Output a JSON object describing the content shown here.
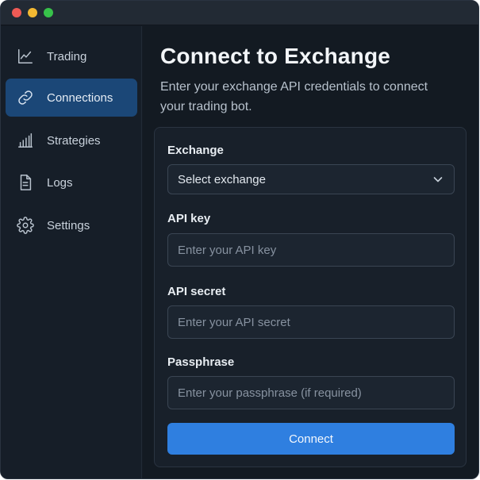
{
  "window": {
    "controls": [
      "close",
      "minimize",
      "maximize"
    ]
  },
  "sidebar": {
    "items": [
      {
        "label": "Trading",
        "icon": "trending-chart-icon",
        "active": false
      },
      {
        "label": "Connections",
        "icon": "link-icon",
        "active": true
      },
      {
        "label": "Strategies",
        "icon": "bar-chart-icon",
        "active": false
      },
      {
        "label": "Logs",
        "icon": "document-icon",
        "active": false
      },
      {
        "label": "Settings",
        "icon": "gear-icon",
        "active": false
      }
    ]
  },
  "main": {
    "title": "Connect to Exchange",
    "subtitle": "Enter your exchange API credentials to connect your trading bot."
  },
  "form": {
    "exchange": {
      "label": "Exchange",
      "value": "Select exchange"
    },
    "api_key": {
      "label": "API key",
      "placeholder": "Enter your API key",
      "value": ""
    },
    "api_secret": {
      "label": "API secret",
      "placeholder": "Enter your API secret",
      "value": ""
    },
    "passphrase": {
      "label": "Passphrase",
      "placeholder": "Enter your passphrase (if required)",
      "value": ""
    },
    "submit_label": "Connect"
  },
  "colors": {
    "accent": "#2f7fe0",
    "active_nav": "#1b4777",
    "background": "#131a22",
    "sidebar": "#161e28",
    "card": "#18202a"
  }
}
